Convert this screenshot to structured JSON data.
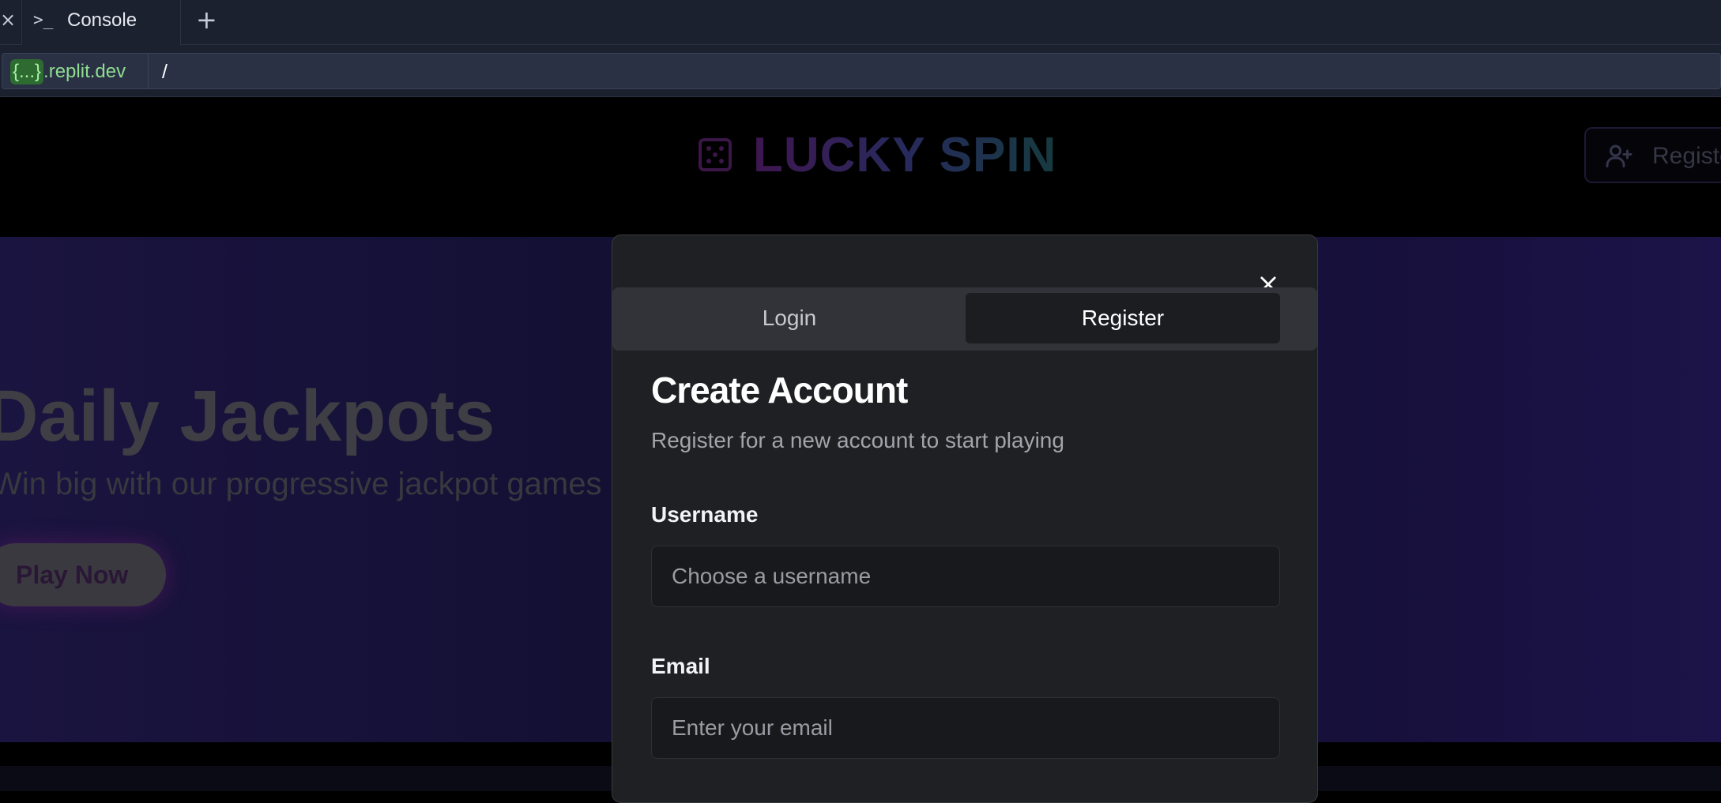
{
  "browser": {
    "tab_close_glyph": "×",
    "tab": {
      "icon": "terminal-icon",
      "icon_glyph": ">_",
      "label": "Console"
    },
    "new_tab_glyph": "+",
    "url": {
      "badge": "{...}",
      "host_suffix": ".replit.dev",
      "path": "/"
    }
  },
  "app": {
    "logo": {
      "icon": "dice-icon",
      "text": "LUCKY SPIN"
    },
    "header_register_label": "Register",
    "header_register_icon": "user-plus-icon",
    "hero": {
      "title": "Daily Jackpots",
      "subtitle": "Win big with our progressive jackpot games",
      "cta_label": "Play Now"
    }
  },
  "modal": {
    "close_icon": "close-icon",
    "tabs": {
      "login": "Login",
      "register": "Register",
      "active": "register"
    },
    "title": "Create Account",
    "description": "Register for a new account to start playing",
    "fields": [
      {
        "label": "Username",
        "placeholder": "Choose a username",
        "value": ""
      },
      {
        "label": "Email",
        "placeholder": "Enter your email",
        "value": ""
      }
    ]
  },
  "colors": {
    "modal_bg": "#1f2023",
    "url_host": "#8fdc8f",
    "hero_bg": "#130f32"
  }
}
